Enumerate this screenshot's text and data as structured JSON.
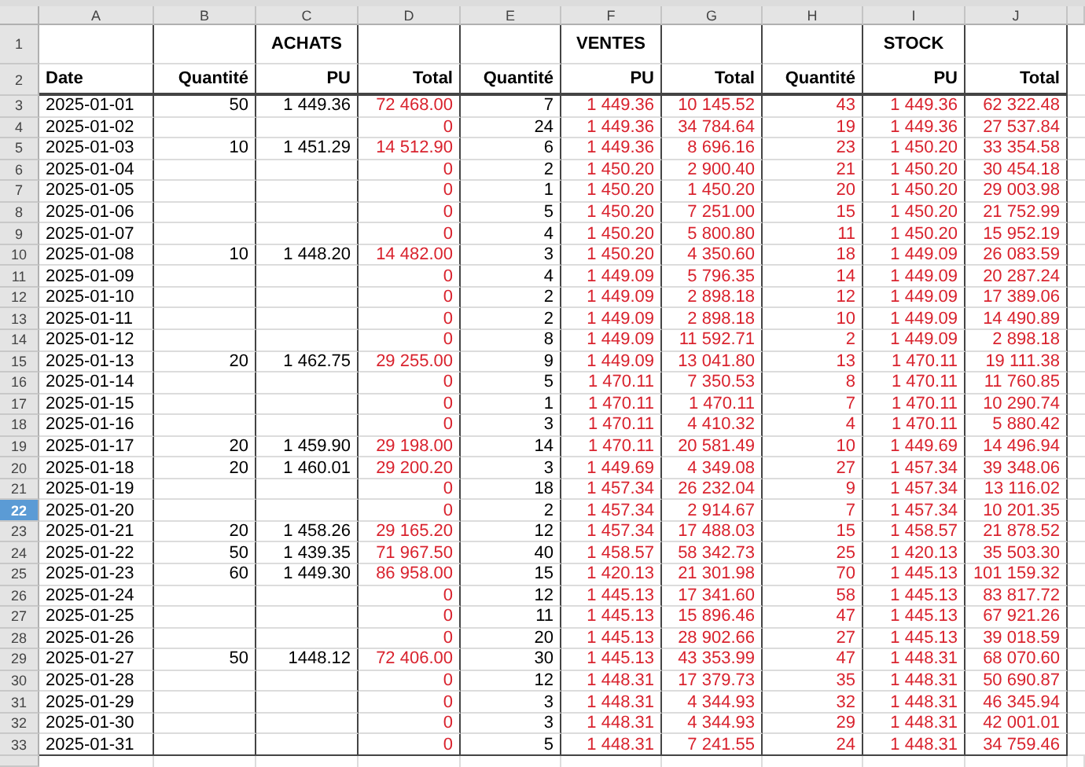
{
  "sheet": {
    "columns": [
      {
        "label": "A",
        "selected": false,
        "kind": "input"
      },
      {
        "label": "B",
        "selected": false,
        "kind": "input"
      },
      {
        "label": "C",
        "selected": false,
        "kind": "input"
      },
      {
        "label": "D",
        "selected": false,
        "kind": "computed"
      },
      {
        "label": "E",
        "selected": false,
        "kind": "input"
      },
      {
        "label": "F",
        "selected": false,
        "kind": "computed"
      },
      {
        "label": "G",
        "selected": false,
        "kind": "computed"
      },
      {
        "label": "H",
        "selected": false,
        "kind": "computed"
      },
      {
        "label": "I",
        "selected": false,
        "kind": "computed"
      },
      {
        "label": "J",
        "selected": false,
        "kind": "computed"
      }
    ],
    "rows": [
      {
        "label": "1",
        "selected": false,
        "kind": "title",
        "cells": [
          null,
          null,
          "ACHATS",
          null,
          null,
          "VENTES",
          null,
          null,
          "STOCK",
          null
        ]
      },
      {
        "label": "2",
        "selected": false,
        "kind": "header",
        "cells": [
          "Date",
          "Quantité",
          "PU",
          "Total",
          "Quantité",
          "PU",
          "Total",
          "Quantité",
          "PU",
          "Total"
        ]
      },
      {
        "label": "3",
        "selected": false,
        "kind": "data",
        "cells": [
          "2025-01-01",
          "50",
          "1 449.36",
          "72 468.00",
          "7",
          "1 449.36",
          "10 145.52",
          "43",
          "1 449.36",
          "62 322.48"
        ]
      },
      {
        "label": "4",
        "selected": false,
        "kind": "data",
        "cells": [
          "2025-01-02",
          null,
          null,
          "0",
          "24",
          "1 449.36",
          "34 784.64",
          "19",
          "1 449.36",
          "27 537.84"
        ]
      },
      {
        "label": "5",
        "selected": false,
        "kind": "data",
        "cells": [
          "2025-01-03",
          "10",
          "1 451.29",
          "14 512.90",
          "6",
          "1 449.36",
          "8 696.16",
          "23",
          "1 450.20",
          "33 354.58"
        ]
      },
      {
        "label": "6",
        "selected": false,
        "kind": "data",
        "cells": [
          "2025-01-04",
          null,
          null,
          "0",
          "2",
          "1 450.20",
          "2 900.40",
          "21",
          "1 450.20",
          "30 454.18"
        ]
      },
      {
        "label": "7",
        "selected": false,
        "kind": "data",
        "cells": [
          "2025-01-05",
          null,
          null,
          "0",
          "1",
          "1 450.20",
          "1 450.20",
          "20",
          "1 450.20",
          "29 003.98"
        ]
      },
      {
        "label": "8",
        "selected": false,
        "kind": "data",
        "cells": [
          "2025-01-06",
          null,
          null,
          "0",
          "5",
          "1 450.20",
          "7 251.00",
          "15",
          "1 450.20",
          "21 752.99"
        ]
      },
      {
        "label": "9",
        "selected": false,
        "kind": "data",
        "cells": [
          "2025-01-07",
          null,
          null,
          "0",
          "4",
          "1 450.20",
          "5 800.80",
          "11",
          "1 450.20",
          "15 952.19"
        ]
      },
      {
        "label": "10",
        "selected": false,
        "kind": "data",
        "cells": [
          "2025-01-08",
          "10",
          "1 448.20",
          "14 482.00",
          "3",
          "1 450.20",
          "4 350.60",
          "18",
          "1 449.09",
          "26 083.59"
        ]
      },
      {
        "label": "11",
        "selected": false,
        "kind": "data",
        "cells": [
          "2025-01-09",
          null,
          null,
          "0",
          "4",
          "1 449.09",
          "5 796.35",
          "14",
          "1 449.09",
          "20 287.24"
        ]
      },
      {
        "label": "12",
        "selected": false,
        "kind": "data",
        "cells": [
          "2025-01-10",
          null,
          null,
          "0",
          "2",
          "1 449.09",
          "2 898.18",
          "12",
          "1 449.09",
          "17 389.06"
        ]
      },
      {
        "label": "13",
        "selected": false,
        "kind": "data",
        "cells": [
          "2025-01-11",
          null,
          null,
          "0",
          "2",
          "1 449.09",
          "2 898.18",
          "10",
          "1 449.09",
          "14 490.89"
        ]
      },
      {
        "label": "14",
        "selected": false,
        "kind": "data",
        "cells": [
          "2025-01-12",
          null,
          null,
          "0",
          "8",
          "1 449.09",
          "11 592.71",
          "2",
          "1 449.09",
          "2 898.18"
        ]
      },
      {
        "label": "15",
        "selected": false,
        "kind": "data",
        "cells": [
          "2025-01-13",
          "20",
          "1 462.75",
          "29 255.00",
          "9",
          "1 449.09",
          "13 041.80",
          "13",
          "1 470.11",
          "19 111.38"
        ]
      },
      {
        "label": "16",
        "selected": false,
        "kind": "data",
        "cells": [
          "2025-01-14",
          null,
          null,
          "0",
          "5",
          "1 470.11",
          "7 350.53",
          "8",
          "1 470.11",
          "11 760.85"
        ]
      },
      {
        "label": "17",
        "selected": false,
        "kind": "data",
        "cells": [
          "2025-01-15",
          null,
          null,
          "0",
          "1",
          "1 470.11",
          "1 470.11",
          "7",
          "1 470.11",
          "10 290.74"
        ]
      },
      {
        "label": "18",
        "selected": false,
        "kind": "data",
        "cells": [
          "2025-01-16",
          null,
          null,
          "0",
          "3",
          "1 470.11",
          "4 410.32",
          "4",
          "1 470.11",
          "5 880.42"
        ]
      },
      {
        "label": "19",
        "selected": false,
        "kind": "data",
        "cells": [
          "2025-01-17",
          "20",
          "1 459.90",
          "29 198.00",
          "14",
          "1 470.11",
          "20 581.49",
          "10",
          "1 449.69",
          "14 496.94"
        ]
      },
      {
        "label": "20",
        "selected": false,
        "kind": "data",
        "cells": [
          "2025-01-18",
          "20",
          "1 460.01",
          "29 200.20",
          "3",
          "1 449.69",
          "4 349.08",
          "27",
          "1 457.34",
          "39 348.06"
        ]
      },
      {
        "label": "21",
        "selected": false,
        "kind": "data",
        "cells": [
          "2025-01-19",
          null,
          null,
          "0",
          "18",
          "1 457.34",
          "26 232.04",
          "9",
          "1 457.34",
          "13 116.02"
        ]
      },
      {
        "label": "22",
        "selected": true,
        "kind": "data",
        "cells": [
          "2025-01-20",
          null,
          null,
          "0",
          "2",
          "1 457.34",
          "2 914.67",
          "7",
          "1 457.34",
          "10 201.35"
        ]
      },
      {
        "label": "23",
        "selected": false,
        "kind": "data",
        "cells": [
          "2025-01-21",
          "20",
          "1 458.26",
          "29 165.20",
          "12",
          "1 457.34",
          "17 488.03",
          "15",
          "1 458.57",
          "21 878.52"
        ]
      },
      {
        "label": "24",
        "selected": false,
        "kind": "data",
        "cells": [
          "2025-01-22",
          "50",
          "1 439.35",
          "71 967.50",
          "40",
          "1 458.57",
          "58 342.73",
          "25",
          "1 420.13",
          "35 503.30"
        ]
      },
      {
        "label": "25",
        "selected": false,
        "kind": "data",
        "cells": [
          "2025-01-23",
          "60",
          "1 449.30",
          "86 958.00",
          "15",
          "1 420.13",
          "21 301.98",
          "70",
          "1 445.13",
          "101 159.32"
        ]
      },
      {
        "label": "26",
        "selected": false,
        "kind": "data",
        "cells": [
          "2025-01-24",
          null,
          null,
          "0",
          "12",
          "1 445.13",
          "17 341.60",
          "58",
          "1 445.13",
          "83 817.72"
        ]
      },
      {
        "label": "27",
        "selected": false,
        "kind": "data",
        "cells": [
          "2025-01-25",
          null,
          null,
          "0",
          "11",
          "1 445.13",
          "15 896.46",
          "47",
          "1 445.13",
          "67 921.26"
        ]
      },
      {
        "label": "28",
        "selected": false,
        "kind": "data",
        "cells": [
          "2025-01-26",
          null,
          null,
          "0",
          "20",
          "1 445.13",
          "28 902.66",
          "27",
          "1 445.13",
          "39 018.59"
        ]
      },
      {
        "label": "29",
        "selected": false,
        "kind": "data",
        "cells": [
          "2025-01-27",
          "50",
          "1448.12",
          "72 406.00",
          "30",
          "1 445.13",
          "43 353.99",
          "47",
          "1 448.31",
          "68 070.60"
        ]
      },
      {
        "label": "30",
        "selected": false,
        "kind": "data",
        "cells": [
          "2025-01-28",
          null,
          null,
          "0",
          "12",
          "1 448.31",
          "17 379.73",
          "35",
          "1 448.31",
          "50 690.87"
        ]
      },
      {
        "label": "31",
        "selected": false,
        "kind": "data",
        "cells": [
          "2025-01-29",
          null,
          null,
          "0",
          "3",
          "1 448.31",
          "4 344.93",
          "32",
          "1 448.31",
          "46 345.94"
        ]
      },
      {
        "label": "32",
        "selected": false,
        "kind": "data",
        "cells": [
          "2025-01-30",
          null,
          null,
          "0",
          "3",
          "1 448.31",
          "4 344.93",
          "29",
          "1 448.31",
          "42 001.01"
        ]
      },
      {
        "label": "33",
        "selected": false,
        "kind": "data",
        "cells": [
          "2025-01-31",
          null,
          null,
          "0",
          "5",
          "1 448.31",
          "7 241.55",
          "24",
          "1 448.31",
          "34 759.46"
        ]
      }
    ]
  }
}
